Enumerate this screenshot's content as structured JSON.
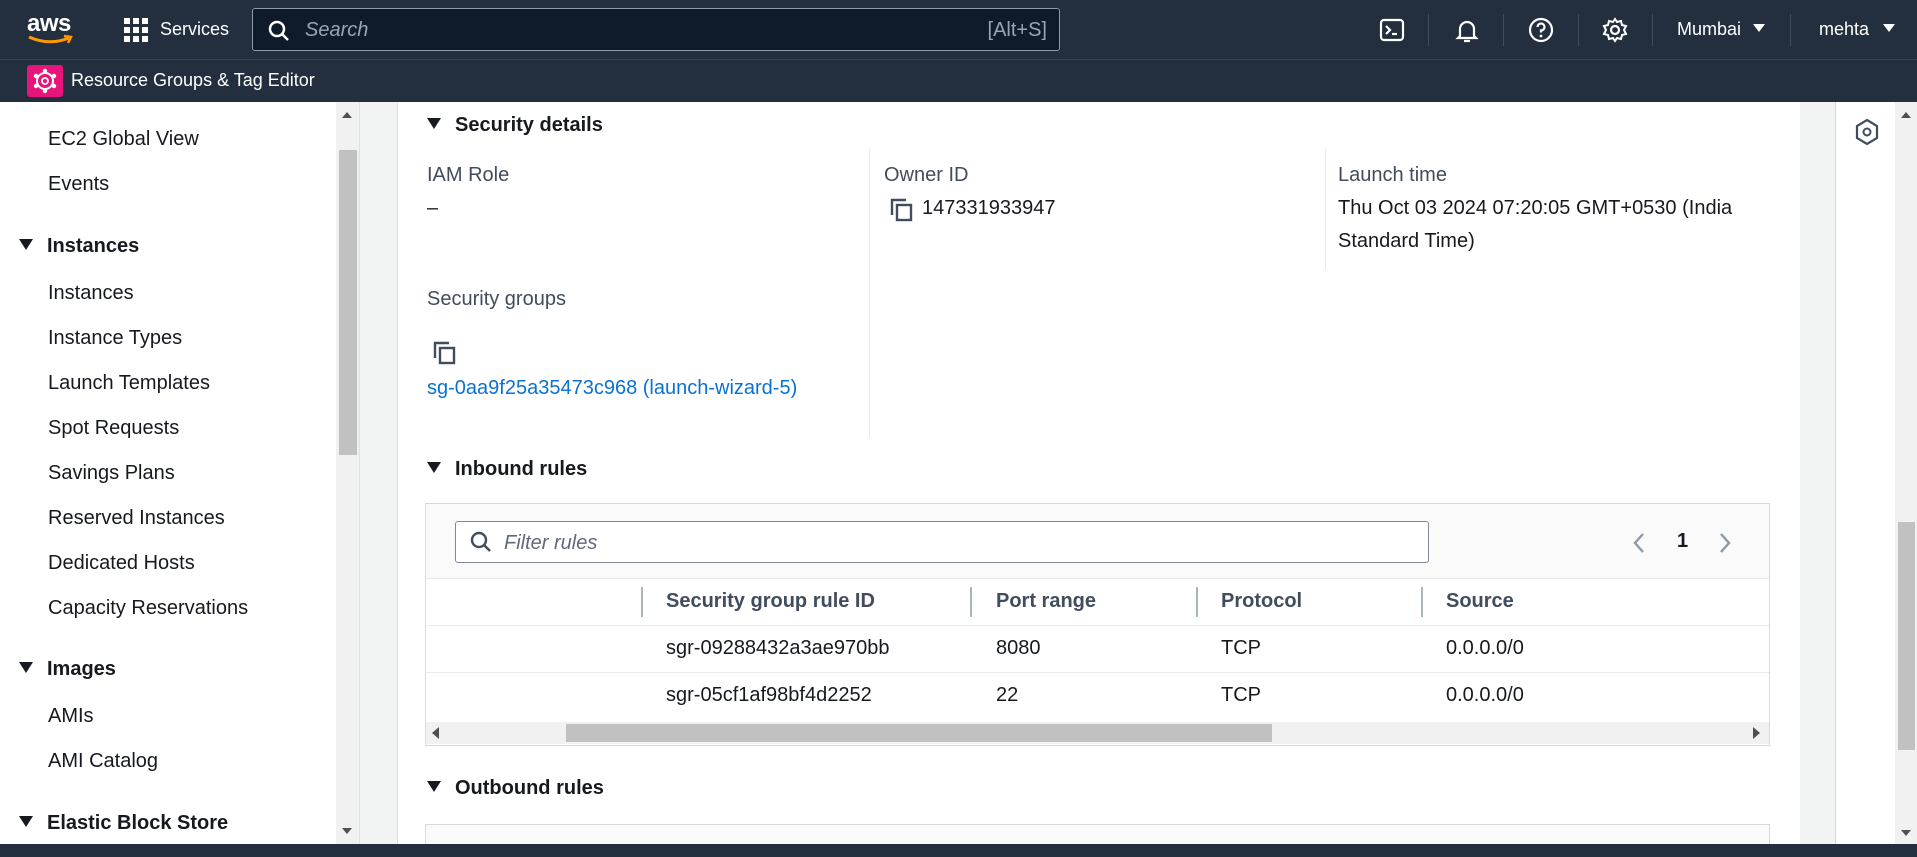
{
  "topnav": {
    "logo_text": "aws",
    "services_label": "Services",
    "search_placeholder": "Search",
    "search_shortcut": "[Alt+S]",
    "region": "Mumbai",
    "user": "mehta"
  },
  "subnav": {
    "label": "Resource Groups & Tag Editor"
  },
  "sidebar": {
    "items_top": [
      "EC2 Global View",
      "Events"
    ],
    "instances_header": "Instances",
    "instances_items": [
      "Instances",
      "Instance Types",
      "Launch Templates",
      "Spot Requests",
      "Savings Plans",
      "Reserved Instances",
      "Dedicated Hosts",
      "Capacity Reservations"
    ],
    "images_header": "Images",
    "images_items": [
      "AMIs",
      "AMI Catalog"
    ],
    "ebs_header": "Elastic Block Store"
  },
  "security_details": {
    "title": "Security details",
    "iam_role_label": "IAM Role",
    "iam_role_value": "–",
    "owner_id_label": "Owner ID",
    "owner_id_value": "147331933947",
    "launch_time_label": "Launch time",
    "launch_time_line1": "Thu Oct 03 2024 07:20:05 GMT+0530 (India",
    "launch_time_line2": "Standard Time)",
    "security_groups_label": "Security groups",
    "security_group_link": "sg-0aa9f25a35473c968 (launch-wizard-5)"
  },
  "inbound_rules": {
    "title": "Inbound rules",
    "filter_placeholder": "Filter rules",
    "page": "1",
    "columns": [
      "Security group rule ID",
      "Port range",
      "Protocol",
      "Source"
    ],
    "rows": [
      [
        "sgr-09288432a3ae970bb",
        "8080",
        "TCP",
        "0.0.0.0/0"
      ],
      [
        "sgr-05cf1af98bf4d2252",
        "22",
        "TCP",
        "0.0.0.0/0"
      ]
    ]
  },
  "outbound_rules": {
    "title": "Outbound rules"
  },
  "colors": {
    "nav_bg": "#232f3e",
    "link": "#0972d3",
    "rg_badge": "#e7157b"
  }
}
